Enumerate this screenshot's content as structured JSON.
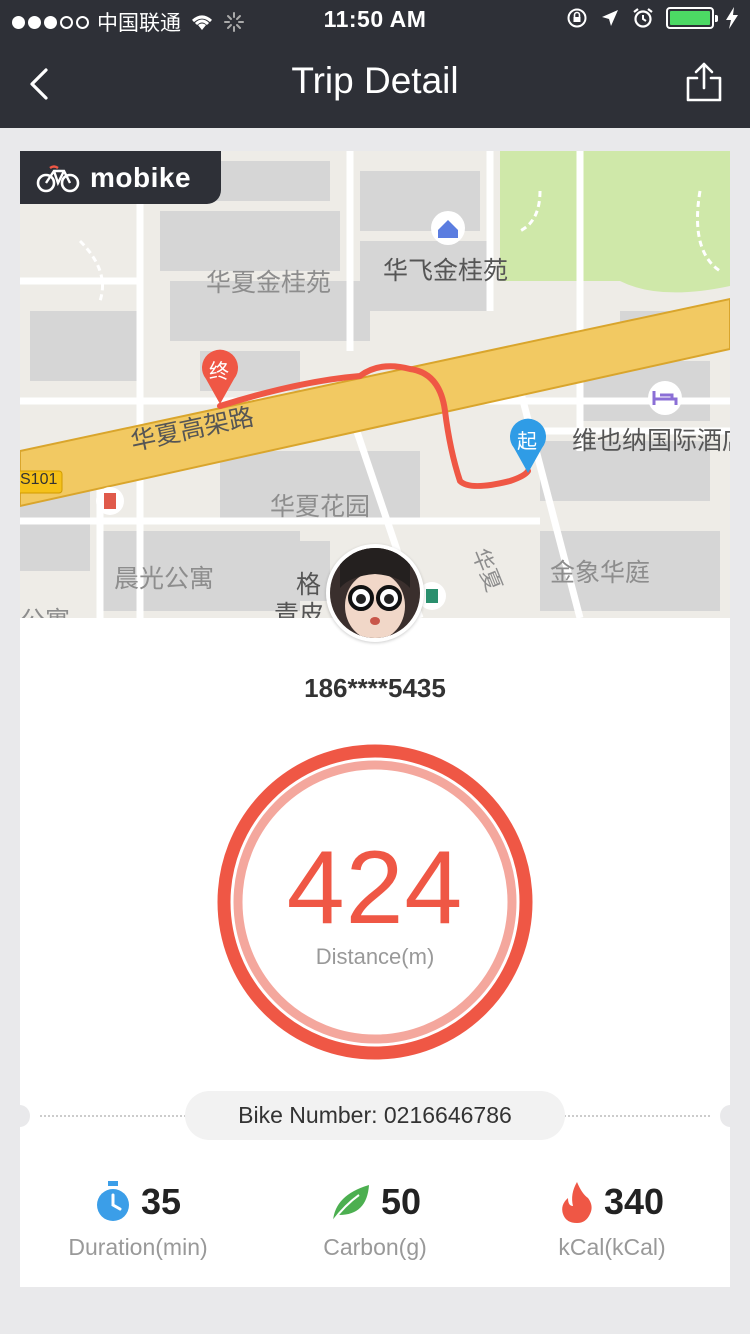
{
  "status_bar": {
    "carrier": "中国联通",
    "time": "11:50 AM"
  },
  "nav": {
    "title": "Trip Detail"
  },
  "brand": {
    "name": "mobike"
  },
  "map": {
    "labels": {
      "poi_1": "华夏金桂苑",
      "poi_2": "华飞金桂苑",
      "road": "华夏高架路",
      "poi_3": "维也纳国际酒店",
      "route_shield": "S101",
      "poi_4": "华夏花园",
      "poi_5": "晨光公寓",
      "poi_6": "金象华庭",
      "poi_7": "格",
      "poi_8": "青皮",
      "road_2": "华夏",
      "poi_9": "公寓",
      "end_marker": "终",
      "start_marker": "起"
    }
  },
  "user": {
    "phone": "186****5435"
  },
  "distance": {
    "value": "424",
    "label": "Distance(m)"
  },
  "bike": {
    "number_text": "Bike Number: 0216646786"
  },
  "stats": {
    "duration": {
      "value": "35",
      "label": "Duration(min)"
    },
    "carbon": {
      "value": "50",
      "label": "Carbon(g)"
    },
    "calories": {
      "value": "340",
      "label": "kCal(kCal)"
    }
  },
  "colors": {
    "accent": "#ef5745",
    "header": "#2e3037",
    "duration_icon": "#3b9ee8",
    "carbon_icon": "#4caf50",
    "calories_icon": "#ef5745"
  }
}
